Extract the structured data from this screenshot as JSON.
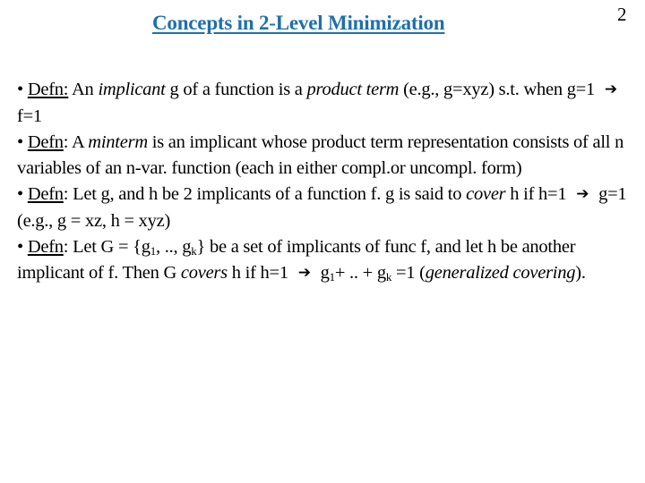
{
  "slide": {
    "title": "Concepts in 2-Level Minimization",
    "page_number": "2",
    "title_color": "#1f6fad"
  },
  "icons": {
    "bullet": "•",
    "implies_arrow": "➔"
  },
  "paragraphs": [
    {
      "label": "Defn:",
      "t1": " An ",
      "em1": "implicant",
      "t2": " g of a function is a ",
      "em2": "product term",
      "t3": " (e.g., g=xyz) s.t. when g=1 ",
      "t4": " f=1"
    },
    {
      "label": "Defn",
      "t1": ": A ",
      "em1": "minterm",
      "t2": " is an implicant whose product term representation consists of all n variables of an n-var. function (each in either compl.or uncompl. form)"
    },
    {
      "label": "Defn",
      "t1": ": Let g, and h be 2 implicants of a function f. g is said to ",
      "em1": "cover",
      "t2": " h if h=1 ",
      "t3": " g=1 (e.g., g = xz, h = xyz)"
    },
    {
      "label": "Defn",
      "t1": ": Let G = {g",
      "sub1": "1",
      "t2": ", .., g",
      "sub2": "k",
      "t3": "} be a set of implicants of func f, and let h be another implicant of f. Then G ",
      "em1": "covers",
      "t4": " h if h=1 ",
      "t5": " g",
      "sub3": "1",
      "t6": "+ .. + g",
      "sub4": "k",
      "t7": " =1 (",
      "em2": "generalized covering",
      "t8": ")."
    }
  ]
}
